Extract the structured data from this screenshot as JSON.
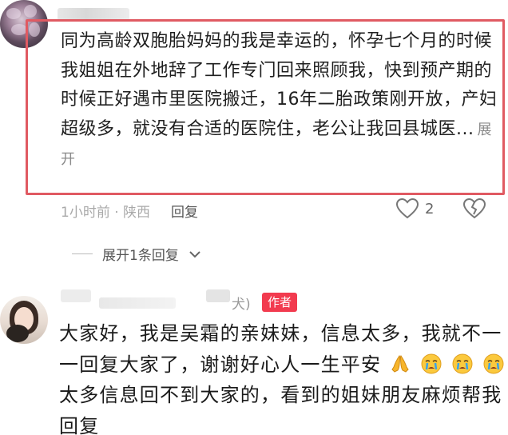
{
  "comment1": {
    "text": "同为高龄双胞胎妈妈的我是幸运的，怀孕七个月的时候我姐姐在外地辞了工作专门回来照顾我，快到预产期的时候正好遇市里医院搬迁，16年二胎政策刚开放，产妇超级多，就没有合适的医院住，老公让我回县城医...",
    "expand_label": "展开",
    "time_location": "1小时前 · 陕西",
    "reply_label": "回复",
    "like_count": "2"
  },
  "replies": {
    "expand_label": "展开1条回复"
  },
  "comment2": {
    "name_suffix": "犬)",
    "author_badge": "作者",
    "line1": "大家好，我是吴霜的亲妹妹，信息太多，我就不一一回复大家了，谢谢好心人一生平安",
    "line2": "太多信息回不到大家的，看到的姐妹朋友麻烦帮我回复"
  },
  "colors": {
    "highlight_border": "#e05a62",
    "author_badge_bg": "#f23b4f",
    "meta_gray": "#a9a9a9"
  },
  "icons": [
    "heart-icon",
    "broken-heart-icon",
    "chevron-down-icon",
    "praying-hands-emoji",
    "crying-face-emoji"
  ]
}
